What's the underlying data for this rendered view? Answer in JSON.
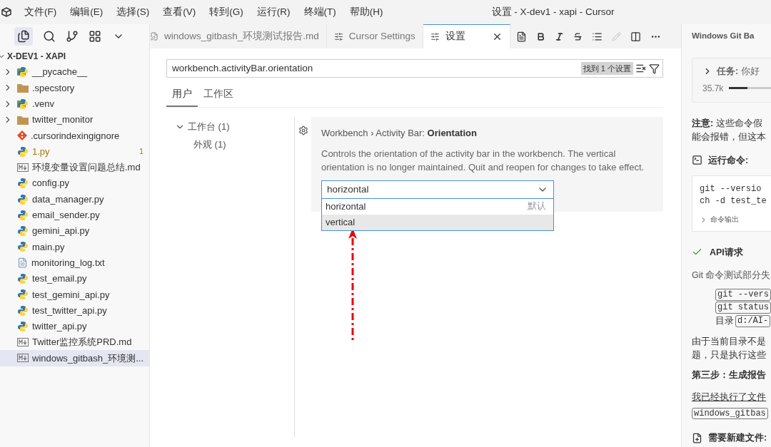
{
  "menu_bar": {
    "items": [
      "文件(F)",
      "编辑(E)",
      "选择(S)",
      "查看(V)",
      "转到(G)",
      "运行(R)",
      "终端(T)",
      "帮助(H)"
    ],
    "title": "设置 - X-dev1 - xapi - Cursor"
  },
  "explorer": {
    "title": "X-DEV1 - XAPI",
    "expanded": true,
    "items": [
      {
        "name": "__pycache__",
        "kind": "folder-python",
        "expanded": false,
        "selected": false
      },
      {
        "name": ".specstory",
        "kind": "folder",
        "expanded": false,
        "selected": false
      },
      {
        "name": ".venv",
        "kind": "folder-python",
        "expanded": false,
        "selected": false
      },
      {
        "name": "twitter_monitor",
        "kind": "folder",
        "expanded": false,
        "selected": false
      },
      {
        "name": ".cursorindexingignore",
        "kind": "git",
        "selected": false
      },
      {
        "name": "1.py",
        "kind": "python",
        "badge": "1",
        "warning": true,
        "selected": false
      },
      {
        "name": "环境变量设置问题总结.md",
        "kind": "markdown",
        "selected": false
      },
      {
        "name": "config.py",
        "kind": "python",
        "selected": false
      },
      {
        "name": "data_manager.py",
        "kind": "python",
        "selected": false
      },
      {
        "name": "email_sender.py",
        "kind": "python",
        "selected": false
      },
      {
        "name": "gemini_api.py",
        "kind": "python",
        "selected": false
      },
      {
        "name": "main.py",
        "kind": "python",
        "selected": false
      },
      {
        "name": "monitoring_log.txt",
        "kind": "text",
        "selected": false
      },
      {
        "name": "test_email.py",
        "kind": "python",
        "selected": false
      },
      {
        "name": "test_gemini_api.py",
        "kind": "python",
        "selected": false
      },
      {
        "name": "test_twitter_api.py",
        "kind": "python",
        "selected": false
      },
      {
        "name": "twitter_api.py",
        "kind": "python",
        "selected": false
      },
      {
        "name": "Twitter监控系统PRD.md",
        "kind": "markdown",
        "selected": false
      },
      {
        "name": "windows_gitbash_环境测...",
        "kind": "markdown",
        "selected": true
      }
    ]
  },
  "tabs": [
    {
      "label": "windows_gitbash_环境测试报告.md",
      "kind": "markdown",
      "selected": false
    },
    {
      "label": "Cursor Settings",
      "kind": "settings",
      "selected": false
    },
    {
      "label": "设置",
      "kind": "settings",
      "selected": true
    }
  ],
  "settings": {
    "search_value": "workbench.activityBar.orientation",
    "result_badge": "找到 1 个设置",
    "scopes": [
      {
        "label": "用户",
        "selected": true
      },
      {
        "label": "工作区",
        "selected": false
      }
    ],
    "toc": [
      {
        "label": "工作台 (1)",
        "expanded": true,
        "children": [
          {
            "label": "外观 (1)"
          }
        ]
      }
    ],
    "setting": {
      "title": "Workbench › Activity Bar: **Orientation**",
      "description": "Controls the orientation of the activity bar in the workbench. The vertical orientation is no longer maintained. Quit and reopen for changes to take effect.",
      "value": "horizontal",
      "options": [
        {
          "label": "horizontal",
          "note": "默认",
          "highlighted": false
        },
        {
          "label": "vertical",
          "highlighted": true
        }
      ]
    }
  },
  "chat_panel": {
    "title": "Windows Git Ba",
    "task": "**任务:** 你好",
    "token_count": "35.7k",
    "level": 0.3,
    "note_lines": [
      "**注意:** 这些命令假",
      "能会报错，但这本"
    ],
    "run_heading": "运行命令:",
    "command_lines": [
      "git --versio",
      "ch -d test_te"
    ],
    "output_label": "命令输出",
    "api_heading": "API请求",
    "api_text": "Git 命令测试部分失",
    "code_lines": [
      {
        "code": "git --vers"
      },
      {
        "code": "git status"
      },
      {
        "prefix": "目录",
        "code": "d:/AI-"
      }
    ],
    "para_lines": [
      "由于当前目录不是",
      "题，只是执行这些"
    ],
    "step_heading": "第三步：生成报告",
    "link_text": "我已经执行了文件",
    "file_code": "windows_gitbas",
    "new_file_heading": "需要新建文件:"
  }
}
